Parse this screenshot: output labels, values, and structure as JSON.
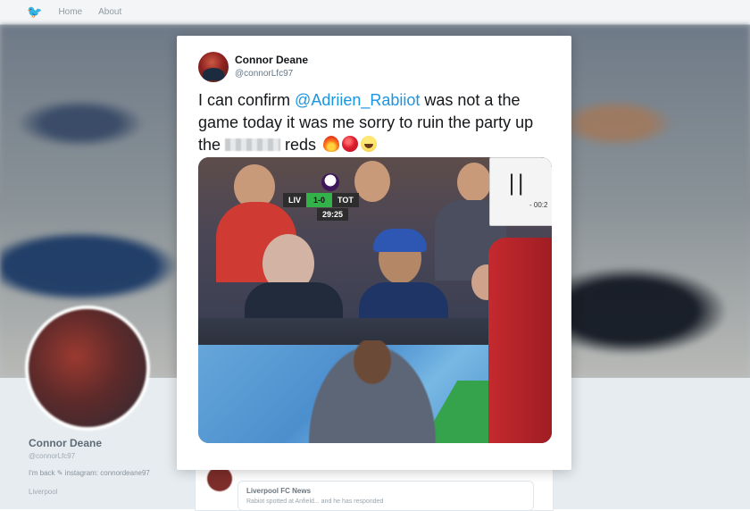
{
  "background": {
    "nav": {
      "home_label": "Home",
      "about_label": "About"
    },
    "profile": {
      "name": "Connor Deane",
      "handle": "@connorLfc97",
      "bio": "I'm back ✎ instagram: connordeane97",
      "location": "Liverpool"
    },
    "feed": {
      "retweeted_name": "Liverpool FC News",
      "retweeted_text": "Rabiot spotted at Anfield... and he has responded"
    }
  },
  "tweet": {
    "author_name": "Connor Deane",
    "author_handle": "@connorLfc97",
    "text_part1": "I can confirm ",
    "mention": "@Adriien_Rabiiot",
    "text_part2": " was not a the game today it was me sorry to ruin the party up the ",
    "text_part3": " reds",
    "emojis": [
      "fire",
      "red-circle",
      "laughing-face"
    ]
  },
  "media": {
    "scorebug": {
      "home": "LIV",
      "score": "1-0",
      "away": "TOT",
      "clock": "29:25"
    },
    "board_text": "- 00:2"
  },
  "colors": {
    "mention": "#1b95e0",
    "score_green": "#33b24a",
    "twitter_blue": "#1da1f2"
  }
}
